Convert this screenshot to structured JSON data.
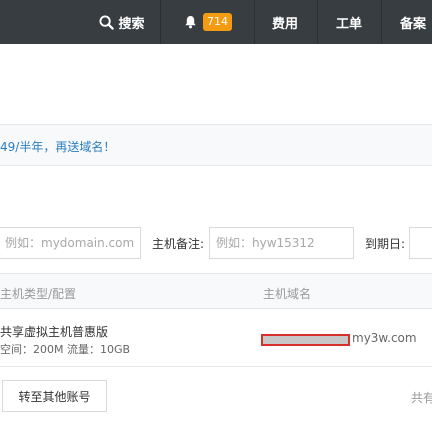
{
  "topbar": {
    "search_label": "搜索",
    "notification_count": "714",
    "fee_label": "费用",
    "ticket_label": "工单",
    "record_label": "备案"
  },
  "promo": {
    "text": "49/半年，再送域名！"
  },
  "filters": {
    "domain_placeholder": "例如：mydomain.com",
    "remark_label": "主机备注:",
    "remark_placeholder": "例如：hyw15312",
    "expire_label": "到期日:"
  },
  "table": {
    "headers": [
      "主机类型/配置",
      "主机域名"
    ],
    "rows": [
      {
        "type_name": "共享虚拟主机普惠版",
        "type_spec": "空间：200M 流量：10GB",
        "domain": "my3w.com"
      }
    ]
  },
  "footer": {
    "switch_account_label": "转至其他账号",
    "total_text": "共有"
  },
  "colors": {
    "topbar_bg": "#373d41",
    "badge_bg": "#f39c12",
    "link_blue": "#2a7dc0",
    "redaction_border": "#d9302a"
  }
}
